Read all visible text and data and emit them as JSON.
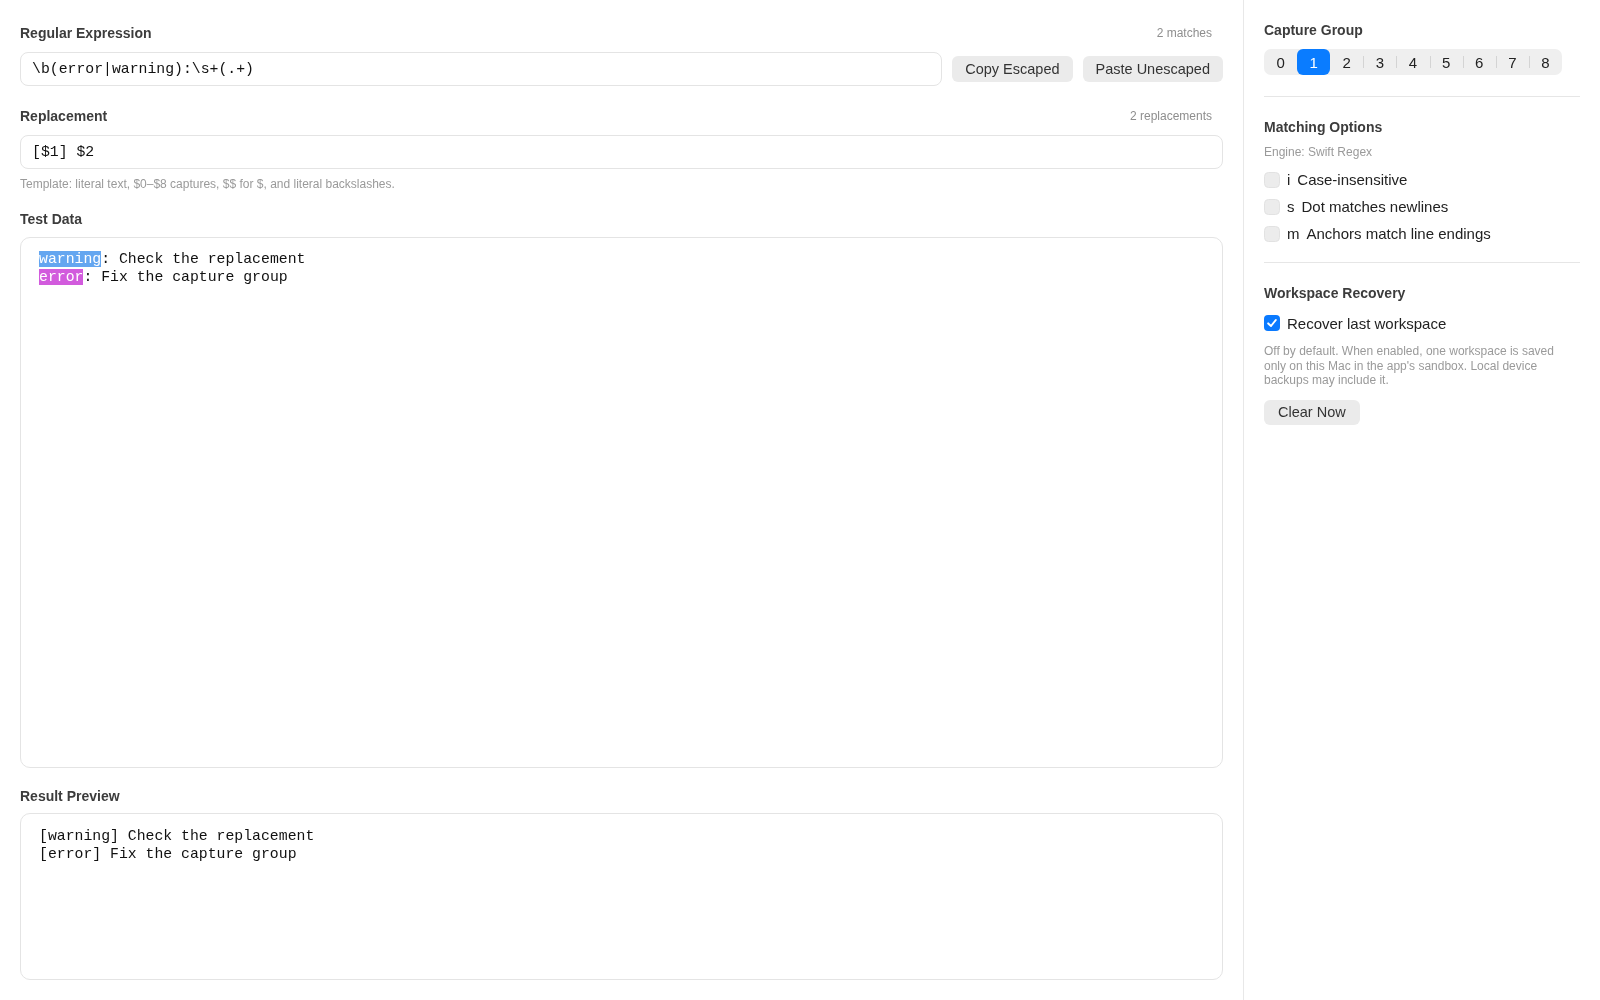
{
  "regex": {
    "label": "Regular Expression",
    "count": "2 matches",
    "value": "\\b(error|warning):\\s+(.+)",
    "buttons": [
      "Copy Escaped",
      "Paste Unescaped"
    ]
  },
  "replacement": {
    "label": "Replacement",
    "count": "2 replacements",
    "value": "[$1] $2",
    "hint": "Template: literal text, $0–$8 captures, $$ for $, and literal backslashes."
  },
  "test_data": {
    "label": "Test Data",
    "lines": [
      {
        "match": "warning",
        "color": "#64a6f0",
        "rest": ": Check the replacement"
      },
      {
        "match": "error",
        "color": "#d25bdd",
        "rest": ": Fix the capture group"
      }
    ]
  },
  "result_preview": {
    "label": "Result Preview",
    "lines": [
      "[warning] Check the replacement",
      "[error] Fix the capture group"
    ]
  },
  "sidebar": {
    "capture_group": {
      "title": "Capture Group",
      "segments": [
        {
          "label": "0",
          "selected": false
        },
        {
          "label": "1",
          "selected": true
        },
        {
          "label": "2",
          "selected": false
        },
        {
          "label": "3",
          "selected": false
        },
        {
          "label": "4",
          "selected": false
        },
        {
          "label": "5",
          "selected": false
        },
        {
          "label": "6",
          "selected": false
        },
        {
          "label": "7",
          "selected": false
        },
        {
          "label": "8",
          "selected": false
        }
      ]
    },
    "matching_options": {
      "title": "Matching Options",
      "engine": "Engine: Swift Regex",
      "options": [
        {
          "flag": "i",
          "label": "Case-insensitive",
          "checked": false
        },
        {
          "flag": "s",
          "label": "Dot matches newlines",
          "checked": false
        },
        {
          "flag": "m",
          "label": "Anchors match line endings",
          "checked": false
        }
      ]
    },
    "workspace_recovery": {
      "title": "Workspace Recovery",
      "checkbox": {
        "label": "Recover last workspace",
        "checked": true
      },
      "description": "Off by default. When enabled, one workspace is saved only on this Mac in the app's sandbox. Local device backups may include it.",
      "button": "Clear Now"
    }
  }
}
